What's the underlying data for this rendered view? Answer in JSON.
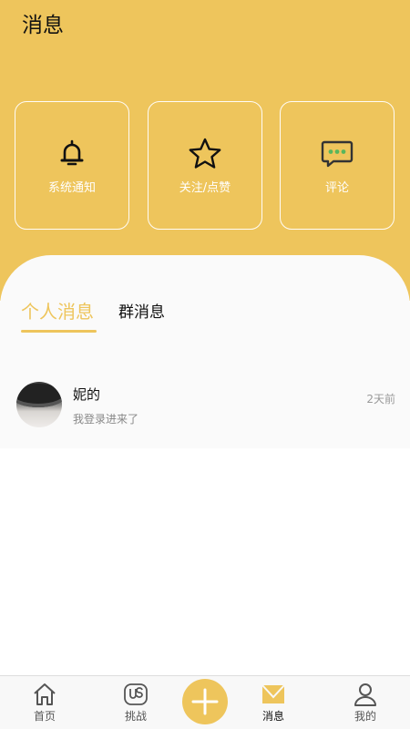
{
  "header": {
    "title": "消息"
  },
  "shortcuts": [
    {
      "label": "系统通知",
      "icon": "bell-icon"
    },
    {
      "label": "关注/点赞",
      "icon": "star-icon"
    },
    {
      "label": "评论",
      "icon": "comment-icon"
    }
  ],
  "tabs": {
    "personal": "个人消息",
    "group": "群消息"
  },
  "messages": [
    {
      "name": "妮的",
      "preview": "我登录进来了",
      "time": "2天前"
    }
  ],
  "bottom_nav": {
    "home": "首页",
    "challenge": "挑战",
    "messages": "消息",
    "me": "我的"
  },
  "colors": {
    "accent": "#EEC55C",
    "panel": "#FAFAFA",
    "comment_dots": "#58B65C"
  }
}
